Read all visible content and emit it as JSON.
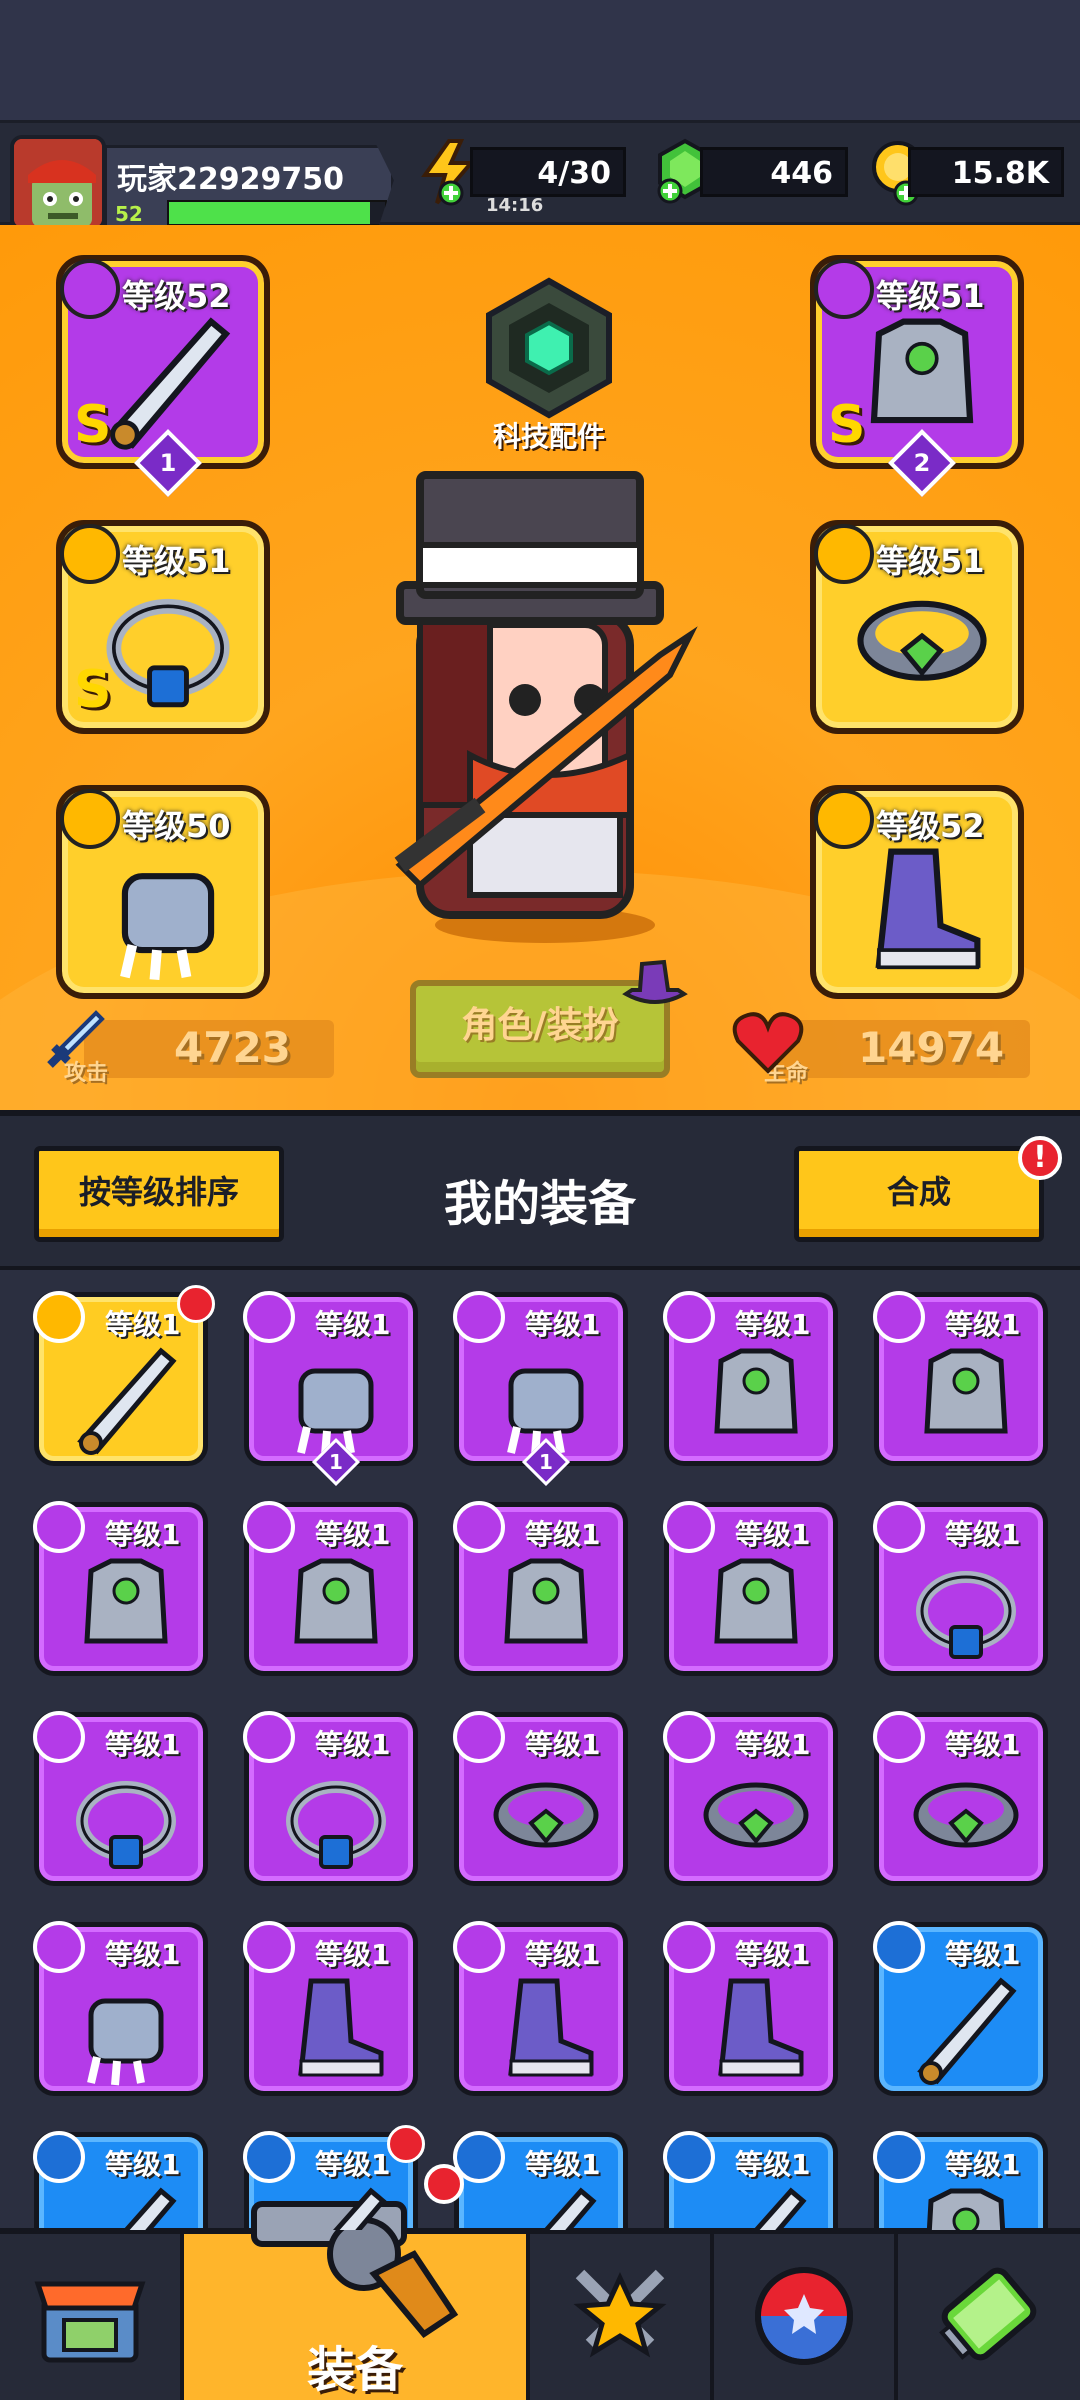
{
  "header": {
    "player_name": "玩家22929750",
    "player_level": "52",
    "xp_fraction": 0.93,
    "energy": "4/30",
    "energy_timer": "14:16",
    "gems": "446",
    "coins": "15.8K"
  },
  "hero": {
    "tech_label": "科技配件",
    "role_button": "角色/装扮",
    "attack_label": "攻击",
    "attack_value": "4723",
    "hp_label": "生命",
    "hp_value": "14974",
    "slots": [
      {
        "level": "等级52",
        "rank": "S",
        "stars": "1",
        "icon": "sword-icon"
      },
      {
        "level": "等级51",
        "rank": "S",
        "stars": "2",
        "icon": "armor-icon"
      },
      {
        "level": "等级51",
        "rank": "S",
        "stars": "",
        "icon": "ring-icon"
      },
      {
        "level": "等级51",
        "rank": "",
        "stars": "",
        "icon": "belt-icon"
      },
      {
        "level": "等级50",
        "rank": "",
        "stars": "",
        "icon": "gauntlet-icon"
      },
      {
        "level": "等级52",
        "rank": "",
        "stars": "",
        "icon": "boot-icon"
      }
    ]
  },
  "bag": {
    "sort_label": "按等级排序",
    "title": "我的装备",
    "merge_label": "合成",
    "merge_alert": "!",
    "items": [
      {
        "level": "等级1",
        "color": "yellow",
        "slot": "weapon",
        "star": "",
        "new": true
      },
      {
        "level": "等级1",
        "color": "purple",
        "slot": "glove",
        "star": "1",
        "new": false
      },
      {
        "level": "等级1",
        "color": "purple",
        "slot": "glove",
        "star": "1",
        "new": false
      },
      {
        "level": "等级1",
        "color": "purple",
        "slot": "armor",
        "star": "",
        "new": false
      },
      {
        "level": "等级1",
        "color": "purple",
        "slot": "armor",
        "star": "",
        "new": false
      },
      {
        "level": "等级1",
        "color": "purple",
        "slot": "armor",
        "star": "",
        "new": false
      },
      {
        "level": "等级1",
        "color": "purple",
        "slot": "armor",
        "star": "",
        "new": false
      },
      {
        "level": "等级1",
        "color": "purple",
        "slot": "armor",
        "star": "",
        "new": false
      },
      {
        "level": "等级1",
        "color": "purple",
        "slot": "armor",
        "star": "",
        "new": false
      },
      {
        "level": "等级1",
        "color": "purple",
        "slot": "ring",
        "star": "",
        "new": false
      },
      {
        "level": "等级1",
        "color": "purple",
        "slot": "ring",
        "star": "",
        "new": false
      },
      {
        "level": "等级1",
        "color": "purple",
        "slot": "ring",
        "star": "",
        "new": false
      },
      {
        "level": "等级1",
        "color": "purple",
        "slot": "belt",
        "star": "",
        "new": false
      },
      {
        "level": "等级1",
        "color": "purple",
        "slot": "belt",
        "star": "",
        "new": false
      },
      {
        "level": "等级1",
        "color": "purple",
        "slot": "belt",
        "star": "",
        "new": false
      },
      {
        "level": "等级1",
        "color": "purple",
        "slot": "glove",
        "star": "",
        "new": false
      },
      {
        "level": "等级1",
        "color": "purple",
        "slot": "boot",
        "star": "",
        "new": false
      },
      {
        "level": "等级1",
        "color": "purple",
        "slot": "boot",
        "star": "",
        "new": false
      },
      {
        "level": "等级1",
        "color": "purple",
        "slot": "boot",
        "star": "",
        "new": false
      },
      {
        "level": "等级1",
        "color": "blue",
        "slot": "weapon",
        "star": "",
        "new": false
      },
      {
        "level": "等级1",
        "color": "blue",
        "slot": "weapon",
        "star": "",
        "new": false
      },
      {
        "level": "等级1",
        "color": "blue",
        "slot": "weapon",
        "star": "",
        "new": true
      },
      {
        "level": "等级1",
        "color": "blue",
        "slot": "weapon",
        "star": "",
        "new": false
      },
      {
        "level": "等级1",
        "color": "blue",
        "slot": "weapon",
        "star": "",
        "new": false
      },
      {
        "level": "等级1",
        "color": "blue",
        "slot": "armor",
        "star": "",
        "new": false
      }
    ]
  },
  "nav": {
    "active_label": "装备",
    "tabs": [
      "shop-icon",
      "equipment-icon",
      "battle-icon",
      "gacha-icon",
      "lab-icon"
    ]
  },
  "colors": {
    "purple": "#b43be8",
    "yellow": "#ffcc22",
    "blue": "#1d8cf5",
    "orange_bg": "#ff9a0a",
    "green_button": "#5ed93b"
  }
}
